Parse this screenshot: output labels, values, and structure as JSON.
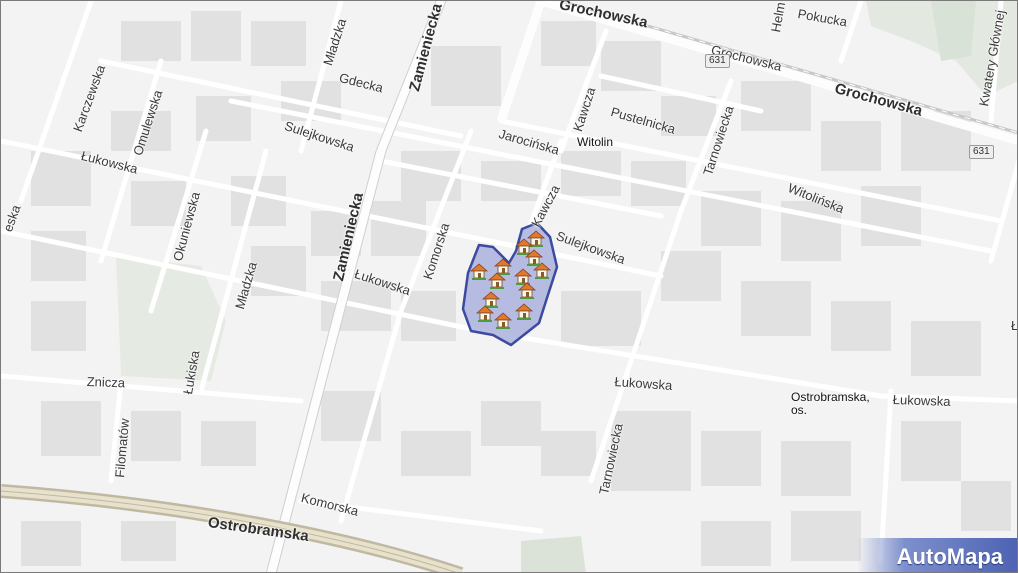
{
  "map": {
    "streets": {
      "grochowska_top": "Grochowska",
      "grochowska_mid": "Grochowska",
      "grochowska_right": "Grochowska",
      "pokucka": "Pokucka",
      "heim": "Helm",
      "kwatery_glownej": "Kwatery Głównej",
      "gdecka": "Gdecka",
      "zamieniecka_top": "Zamieniecka",
      "zamieniecka_mid": "Zamieniecka",
      "mladzka_top": "Mładzka",
      "mladzka_mid": "Mładzka",
      "karczewska": "Karczewska",
      "omulewska": "Omulewska",
      "okuniewska": "Okuniewska",
      "sulejkowska_left": "Sulejkowska",
      "sulejkowska_right": "Sulejkowska",
      "jarocinska": "Jarocińska",
      "pustelnicka": "Pustelnicka",
      "kawcza_top": "Kawcza",
      "kawcza_mid": "Kawcza",
      "tarnowiecka_top": "Tarnowiecka",
      "tarnowiecka_bottom": "Tarnowiecka",
      "witolinska": "Witolińska",
      "lukowska_left": "Łukowska",
      "lukowska_mid": "Łukowska",
      "lukowska_center": "Łukowska",
      "lukowska_right": "Łukowska",
      "komorska_top": "Komorska",
      "komorska_bottom": "Komorska",
      "lukiska": "Łukiska",
      "znicza": "Znicza",
      "filomatow": "Filomatów",
      "ostrobramska": "Ostrobramska",
      "edge_left": "eska",
      "edge_right": "Ł"
    },
    "places": {
      "witolin": "Witolin",
      "ostrobramska_os_line1": "Ostrobramska,",
      "ostrobramska_os_line2": "os."
    },
    "route_shields": {
      "top": "631",
      "right": "631"
    },
    "highlight": {
      "fill_color": "#aab1dd",
      "stroke_color": "#3c4aa0",
      "marker_icon": "house-icon",
      "marker_count": 13
    },
    "brand": "AutoMapa"
  }
}
